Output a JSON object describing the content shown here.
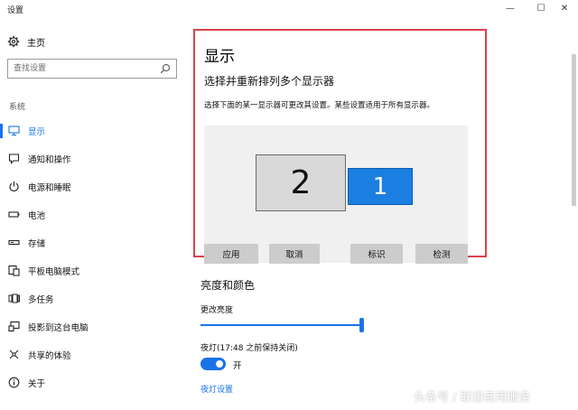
{
  "window": {
    "title": "设置",
    "minimize": "—",
    "maximize": "☐",
    "close": "✕"
  },
  "sidebar": {
    "home_label": "主页",
    "search_placeholder": "查找设置",
    "section_label": "系统",
    "items": [
      {
        "label": "显示",
        "icon": "monitor-icon",
        "active": true
      },
      {
        "label": "通知和操作",
        "icon": "notification-icon"
      },
      {
        "label": "电源和睡眠",
        "icon": "power-icon"
      },
      {
        "label": "电池",
        "icon": "battery-icon"
      },
      {
        "label": "存储",
        "icon": "storage-icon"
      },
      {
        "label": "平板电脑模式",
        "icon": "tablet-mode-icon"
      },
      {
        "label": "多任务",
        "icon": "multitasking-icon"
      },
      {
        "label": "投影到这台电脑",
        "icon": "projecting-icon"
      },
      {
        "label": "共享的体验",
        "icon": "shared-experiences-icon"
      },
      {
        "label": "关于",
        "icon": "info-icon"
      }
    ]
  },
  "main": {
    "title": "显示",
    "subtitle": "选择并重新排列多个显示器",
    "description": "选择下面的某一显示器可更改其设置。某些设置适用于所有显示器。",
    "monitors": [
      {
        "number": "2",
        "selected": false
      },
      {
        "number": "1",
        "selected": true
      }
    ],
    "buttons": {
      "apply": "应用",
      "cancel": "取消",
      "identify": "标识",
      "detect": "检测"
    },
    "section_title": "亮度和颜色",
    "brightness_label": "更改亮度",
    "brightness_value": 1.0,
    "night_light_label": "夜灯(17:48 之前保持关闭)",
    "night_light_toggle_label": "开",
    "night_light_on": true,
    "night_light_settings_link": "夜灯设置"
  },
  "watermark": "头条号 / 联想商用服务",
  "colors": {
    "accent": "#1a73e8",
    "highlight_border": "#d9434e",
    "selected_monitor": "#1a7fe0",
    "button_bg": "#cccccc"
  }
}
